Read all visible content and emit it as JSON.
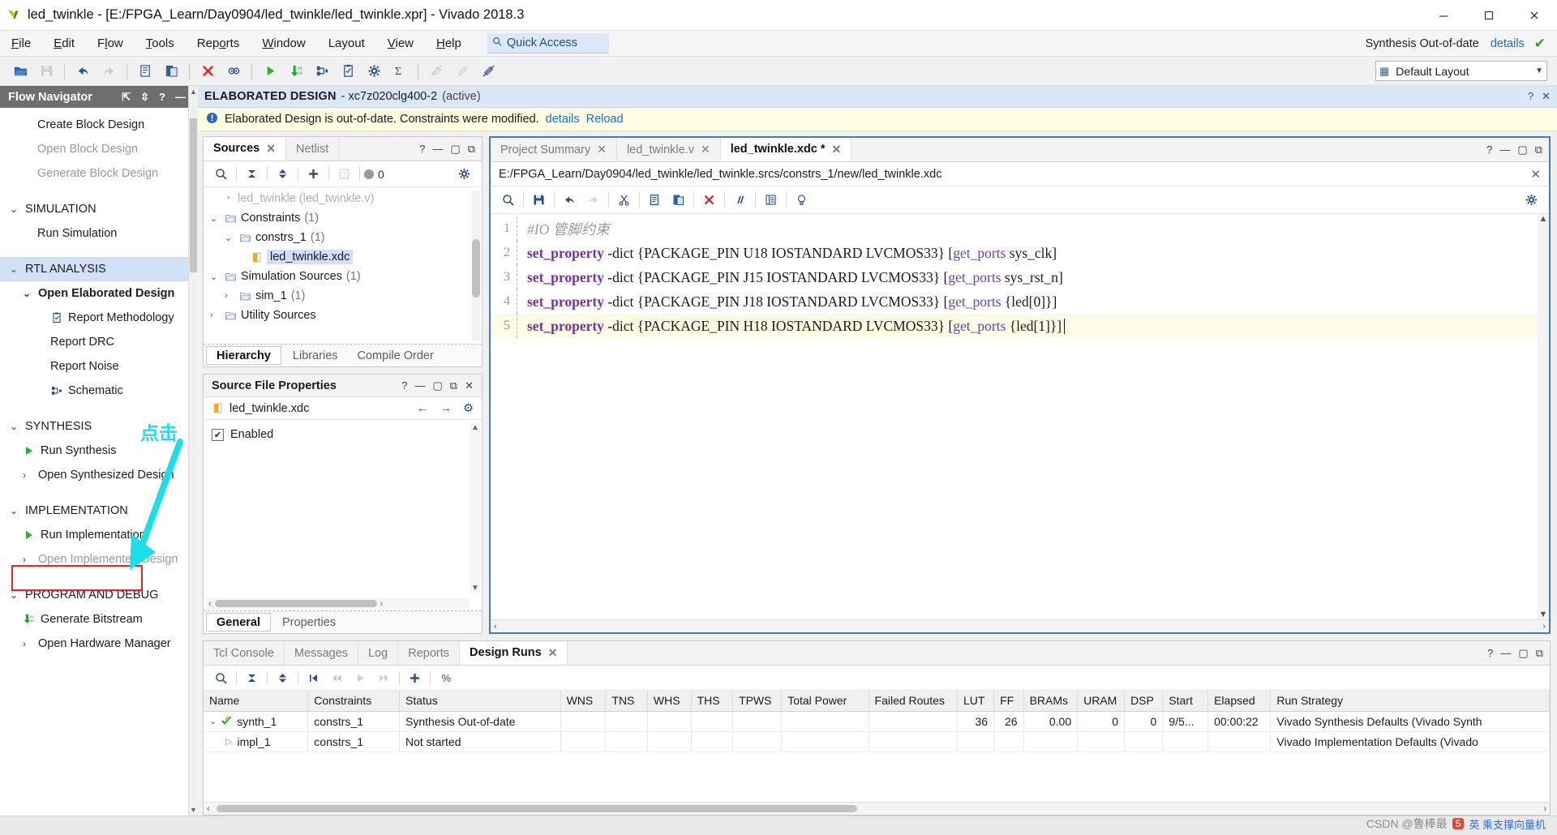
{
  "window": {
    "title": "led_twinkle - [E:/FPGA_Learn/Day0904/led_twinkle/led_twinkle.xpr] - Vivado 2018.3",
    "minimize": "minimize-icon",
    "maximize": "maximize-icon",
    "close": "close-icon"
  },
  "menu": {
    "items": [
      "File",
      "Edit",
      "Flow",
      "Tools",
      "Reports",
      "Window",
      "Layout",
      "View",
      "Help"
    ],
    "quick_access_placeholder": "Quick Access",
    "quick_access_value": "Quick Access",
    "synthesis_status": "Synthesis Out-of-date",
    "details_link": "details"
  },
  "toolbar": {
    "buttons": [
      "open-folder-icon",
      "save-icon",
      "undo-icon",
      "redo-icon",
      "copy-icon",
      "paste-icon",
      "delete-icon",
      "search-replace-icon",
      "run-icon",
      "bitstream-icon",
      "schematic-icon",
      "report-icon",
      "settings-icon",
      "sum-icon",
      "marker-off-icon",
      "highlight-off-icon",
      "unmark-icon"
    ],
    "layout_label": "Default Layout"
  },
  "flow_navigator": {
    "title": "Flow Navigator",
    "items": [
      {
        "label": "Create Block Design",
        "level": "child",
        "state": "normal",
        "icon": ""
      },
      {
        "label": "Open Block Design",
        "level": "child",
        "state": "dim",
        "icon": ""
      },
      {
        "label": "Generate Block Design",
        "level": "child",
        "state": "dim",
        "icon": ""
      },
      {
        "label": "SIMULATION",
        "level": "section",
        "state": "normal",
        "chev": "v",
        "icon": ""
      },
      {
        "label": "Run Simulation",
        "level": "child",
        "state": "normal",
        "icon": ""
      },
      {
        "label": "RTL ANALYSIS",
        "level": "section",
        "state": "active",
        "chev": "v",
        "icon": ""
      },
      {
        "label": "Open Elaborated Design",
        "level": "child",
        "state": "bold",
        "chev": "v",
        "icon": ""
      },
      {
        "label": "Report Methodology",
        "level": "child2",
        "state": "normal",
        "icon": "report-icon"
      },
      {
        "label": "Report DRC",
        "level": "child2",
        "state": "normal",
        "icon": ""
      },
      {
        "label": "Report Noise",
        "level": "child2",
        "state": "normal",
        "icon": ""
      },
      {
        "label": "Schematic",
        "level": "child2",
        "state": "normal",
        "icon": "schematic-icon"
      },
      {
        "label": "SYNTHESIS",
        "level": "section",
        "state": "normal",
        "chev": "v",
        "icon": ""
      },
      {
        "label": "Run Synthesis",
        "level": "child",
        "state": "normal",
        "icon": "play-icon"
      },
      {
        "label": "Open Synthesized Design",
        "level": "child",
        "state": "normal",
        "chev": ">",
        "icon": ""
      },
      {
        "label": "IMPLEMENTATION",
        "level": "section",
        "state": "normal",
        "chev": "v",
        "icon": ""
      },
      {
        "label": "Run Implementation",
        "level": "child",
        "state": "normal",
        "icon": "play-icon",
        "highlighted": true
      },
      {
        "label": "Open Implemented Design",
        "level": "child",
        "state": "dim",
        "chev": ">",
        "icon": ""
      },
      {
        "label": "PROGRAM AND DEBUG",
        "level": "section",
        "state": "normal",
        "chev": "v",
        "icon": ""
      },
      {
        "label": "Generate Bitstream",
        "level": "child",
        "state": "normal",
        "icon": "bitstream-icon"
      },
      {
        "label": "Open Hardware Manager",
        "level": "child",
        "state": "normal",
        "chev": ">",
        "icon": ""
      }
    ]
  },
  "annotation": {
    "text": "点击",
    "arrow_color": "#19dfe8",
    "box_color": "#ee2222"
  },
  "design_bar": {
    "title": "ELABORATED DESIGN",
    "part": "xc7z020clg400-2",
    "state": "(active)"
  },
  "warning_bar": {
    "message": "Elaborated Design is out-of-date. Constraints were modified.",
    "details_link": "details",
    "reload_link": "Reload"
  },
  "sources_panel": {
    "tabs": [
      {
        "label": "Sources",
        "active": true,
        "closable": true
      },
      {
        "label": "Netlist",
        "active": false,
        "closable": false
      }
    ],
    "badge_count": "0",
    "tree": [
      {
        "label": "Constraints",
        "count": "(1)",
        "indent": 0,
        "chev": "v",
        "icon": "folder-icon"
      },
      {
        "label": "constrs_1",
        "count": "(1)",
        "indent": 1,
        "chev": "v",
        "icon": "folder-icon"
      },
      {
        "label": "led_twinkle.xdc",
        "count": "",
        "indent": 2,
        "chev": "",
        "icon": "xdc-file-icon",
        "selected": true
      },
      {
        "label": "Simulation Sources",
        "count": "(1)",
        "indent": 0,
        "chev": "v",
        "icon": "folder-icon"
      },
      {
        "label": "sim_1",
        "count": "(1)",
        "indent": 1,
        "chev": ">",
        "icon": "folder-icon"
      },
      {
        "label": "Utility Sources",
        "count": "",
        "indent": 0,
        "chev": ">",
        "icon": "folder-icon"
      }
    ],
    "subtabs": [
      {
        "label": "Hierarchy",
        "active": true
      },
      {
        "label": "Libraries",
        "active": false
      },
      {
        "label": "Compile Order",
        "active": false
      }
    ]
  },
  "source_file_properties": {
    "title": "Source File Properties",
    "file_name": "led_twinkle.xdc",
    "enabled_label": "Enabled",
    "enabled_checked": true,
    "subtabs": [
      {
        "label": "General",
        "active": true
      },
      {
        "label": "Properties",
        "active": false
      }
    ]
  },
  "editor": {
    "tabs": [
      {
        "label": "Project Summary",
        "active": false,
        "closable": true
      },
      {
        "label": "led_twinkle.v",
        "active": false,
        "closable": true
      },
      {
        "label": "led_twinkle.xdc *",
        "active": true,
        "closable": true
      }
    ],
    "path": "E:/FPGA_Learn/Day0904/led_twinkle/led_twinkle.srcs/constrs_1/new/led_twinkle.xdc",
    "toolbar_buttons": [
      "search-icon",
      "save-icon",
      "undo-icon",
      "redo-icon",
      "cut-icon",
      "copy-icon",
      "paste-icon",
      "delete-icon",
      "comment-icon",
      "indent-icon",
      "bulb-icon"
    ],
    "lines": [
      {
        "n": "1",
        "kind": "comment",
        "text": "#IO 管脚约束"
      },
      {
        "n": "2",
        "kind": "code",
        "cmd": "set_property",
        "mid": " -dict {PACKAGE_PIN U18 IOSTANDARD LVCMOS33} [",
        "fn": "get_ports",
        "tail": " sys_clk]"
      },
      {
        "n": "3",
        "kind": "code",
        "cmd": "set_property",
        "mid": " -dict {PACKAGE_PIN J15 IOSTANDARD LVCMOS33} [",
        "fn": "get_ports",
        "tail": " sys_rst_n]"
      },
      {
        "n": "4",
        "kind": "code",
        "cmd": "set_property",
        "mid": " -dict {PACKAGE_PIN J18 IOSTANDARD LVCMOS33} [",
        "fn": "get_ports",
        "tail": " {led[0]}]"
      },
      {
        "n": "5",
        "kind": "code",
        "cmd": "set_property",
        "mid": " -dict {PACKAGE_PIN H18 IOSTANDARD LVCMOS33} [",
        "fn": "get_ports",
        "tail": " {led[1]}]",
        "highlighted": true,
        "caret": true
      }
    ]
  },
  "console": {
    "tabs": [
      {
        "label": "Tcl Console",
        "active": false,
        "closable": false
      },
      {
        "label": "Messages",
        "active": false,
        "closable": false
      },
      {
        "label": "Log",
        "active": false,
        "closable": false
      },
      {
        "label": "Reports",
        "active": false,
        "closable": false
      },
      {
        "label": "Design Runs",
        "active": true,
        "closable": true
      }
    ],
    "toolbar_buttons": [
      "search-icon",
      "collapse-all-icon",
      "expand-all-icon",
      "first-icon",
      "prev-icon",
      "run-icon",
      "next-icon",
      "add-icon",
      "percent-icon"
    ],
    "columns": [
      "Name",
      "Constraints",
      "Status",
      "WNS",
      "TNS",
      "WHS",
      "THS",
      "TPWS",
      "Total Power",
      "Failed Routes",
      "LUT",
      "FF",
      "BRAMs",
      "URAM",
      "DSP",
      "Start",
      "Elapsed",
      "Run Strategy"
    ],
    "rows": [
      {
        "name": "synth_1",
        "chev": "v",
        "icon": "check-warning-icon",
        "indent": false,
        "constraints": "constrs_1",
        "status": "Synthesis Out-of-date",
        "wns": "",
        "tns": "",
        "whs": "",
        "ths": "",
        "tpws": "",
        "total_power": "",
        "failed_routes": "",
        "lut": "36",
        "ff": "26",
        "brams": "0.00",
        "uram": "0",
        "dsp": "0",
        "start": "9/5...",
        "elapsed": "00:00:22",
        "run_strategy": "Vivado Synthesis Defaults (Vivado Synth"
      },
      {
        "name": "impl_1",
        "chev": ">",
        "icon": "",
        "indent": true,
        "constraints": "constrs_1",
        "status": "Not started",
        "wns": "",
        "tns": "",
        "whs": "",
        "ths": "",
        "tpws": "",
        "total_power": "",
        "failed_routes": "",
        "lut": "",
        "ff": "",
        "brams": "",
        "uram": "",
        "dsp": "",
        "start": "",
        "elapsed": "",
        "run_strategy": "Vivado Implementation Defaults (Vivado"
      }
    ]
  },
  "watermark": {
    "prefix": "CSDN @鲁棒最",
    "badge": "5",
    "suffix": "英 乘支撑向量机"
  }
}
